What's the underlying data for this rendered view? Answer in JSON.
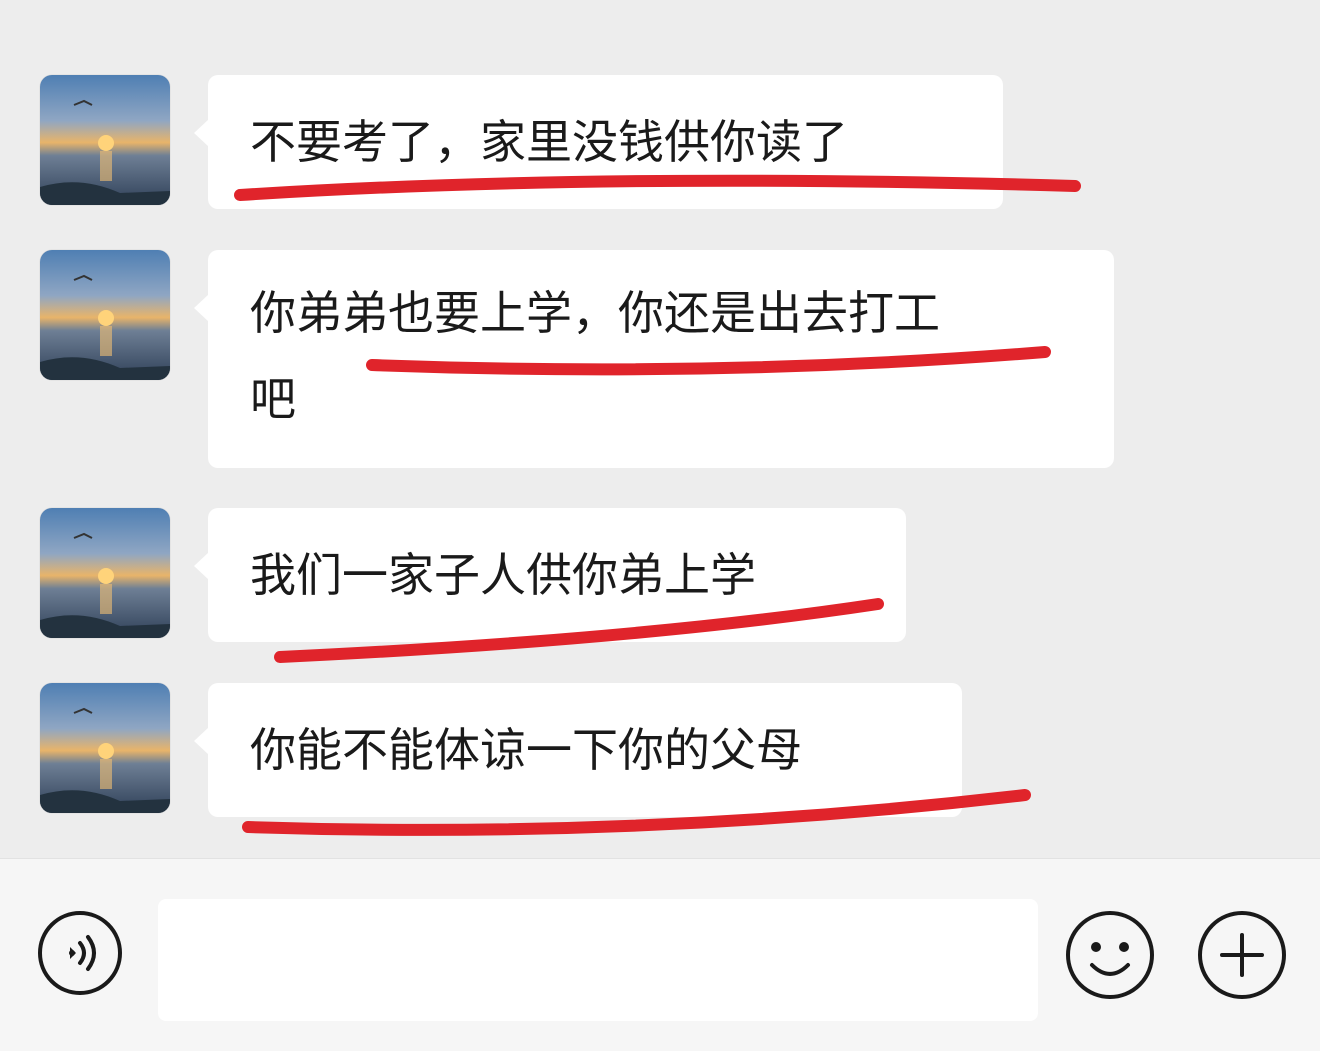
{
  "messages": [
    {
      "line1": "不要考了，家里没钱供你读了",
      "line2": ""
    },
    {
      "line1": "你弟弟也要上学，你还是出去打工",
      "line2": "吧"
    },
    {
      "line1": "我们一家子人供你弟上学",
      "line2": ""
    },
    {
      "line1": "你能不能体谅一下你的父母",
      "line2": ""
    }
  ],
  "avatar_icon": "sunset-sea-photo",
  "annotation_color": "#e0242b",
  "input_bar": {
    "voice_icon": "voice-icon",
    "input_placeholder": "",
    "emoji_icon": "emoji-icon",
    "plus_icon": "plus-icon"
  }
}
